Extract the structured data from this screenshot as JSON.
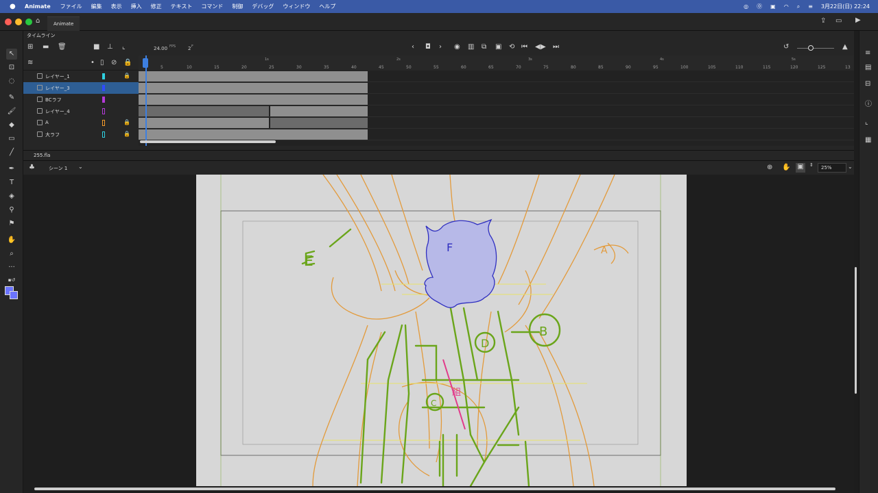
{
  "menubar": {
    "app_name": "Animate",
    "items": [
      "ファイル",
      "編集",
      "表示",
      "挿入",
      "修正",
      "テキスト",
      "コマンド",
      "制御",
      "デバッグ",
      "ウィンドウ",
      "ヘルプ"
    ],
    "datetime": "3月22日(日)  22:24"
  },
  "tabs": {
    "active": "Animate"
  },
  "timeline": {
    "panel_title": "タイムライン",
    "fps": "24.00",
    "fps_unit": "FPS",
    "current_frame": "2",
    "current_frame_unit": "F",
    "layers": [
      {
        "name": "レイヤー_1",
        "color": "#2fd0e0",
        "locked": true,
        "selected": false
      },
      {
        "name": "レイヤー_3",
        "color": "#2f4bff",
        "locked": false,
        "selected": true
      },
      {
        "name": "BCラフ",
        "color": "#b43ad8",
        "locked": false,
        "selected": false
      },
      {
        "name": "レイヤー_4",
        "color": "#b43ad8",
        "locked": false,
        "selected": false
      },
      {
        "name": "A",
        "color": "#f39a2a",
        "locked": true,
        "selected": false
      },
      {
        "name": "大ラフ",
        "color": "#2fd0e0",
        "locked": true,
        "selected": false
      }
    ],
    "frame_ticks": [
      "5",
      "10",
      "15",
      "20",
      "25",
      "30",
      "35",
      "40",
      "45",
      "50",
      "55",
      "60",
      "65",
      "70",
      "75",
      "80",
      "85",
      "90",
      "95",
      "100",
      "105",
      "110",
      "115",
      "120",
      "125",
      "13"
    ],
    "second_markers": [
      "1s",
      "2s",
      "3s",
      "4s",
      "5s"
    ]
  },
  "document": {
    "file_tab": "255.fla",
    "scene": "シーン 1",
    "zoom": "25%"
  },
  "canvas_annotations": {
    "e": "E",
    "f": "F",
    "a": "A",
    "b": "B",
    "d": "D",
    "c": "C",
    "pink_mark": "組"
  },
  "colors": {
    "menubar": "#3a5aa6",
    "selection": "#2e5e94",
    "playhead": "#3d7fe0",
    "green_stroke": "#6aa51a",
    "orange_stroke": "#e39a3a",
    "blue_fill": "#b7b9e8"
  }
}
